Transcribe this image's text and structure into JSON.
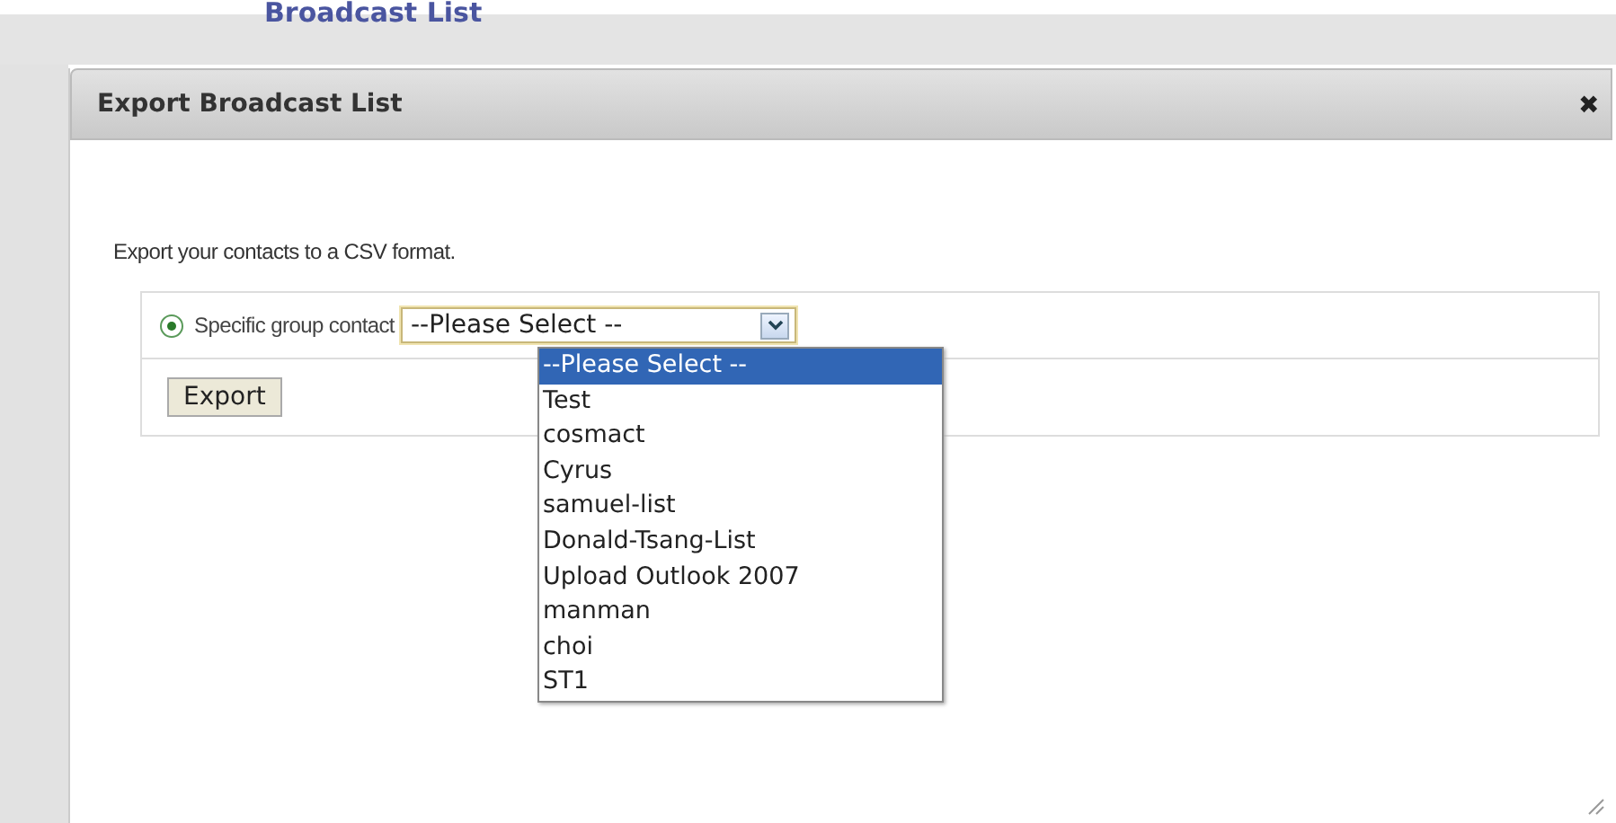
{
  "page": {
    "heading": "Broadcast List"
  },
  "dialog": {
    "title": "Export Broadcast List",
    "close": "✖",
    "intro": "Export your contacts to a CSV format.",
    "option": {
      "label": "Specific group contact",
      "selected": true
    },
    "select": {
      "value": "--Please Select --",
      "expanded": true,
      "options": [
        {
          "label": "--Please Select --",
          "selected": true
        },
        {
          "label": "Test",
          "selected": false
        },
        {
          "label": "cosmact",
          "selected": false
        },
        {
          "label": "Cyrus",
          "selected": false
        },
        {
          "label": "samuel-list",
          "selected": false
        },
        {
          "label": "Donald-Tsang-List",
          "selected": false
        },
        {
          "label": "Upload Outlook 2007",
          "selected": false
        },
        {
          "label": "manman",
          "selected": false
        },
        {
          "label": "choi",
          "selected": false
        },
        {
          "label": "ST1",
          "selected": false
        }
      ]
    },
    "button": "Export"
  }
}
